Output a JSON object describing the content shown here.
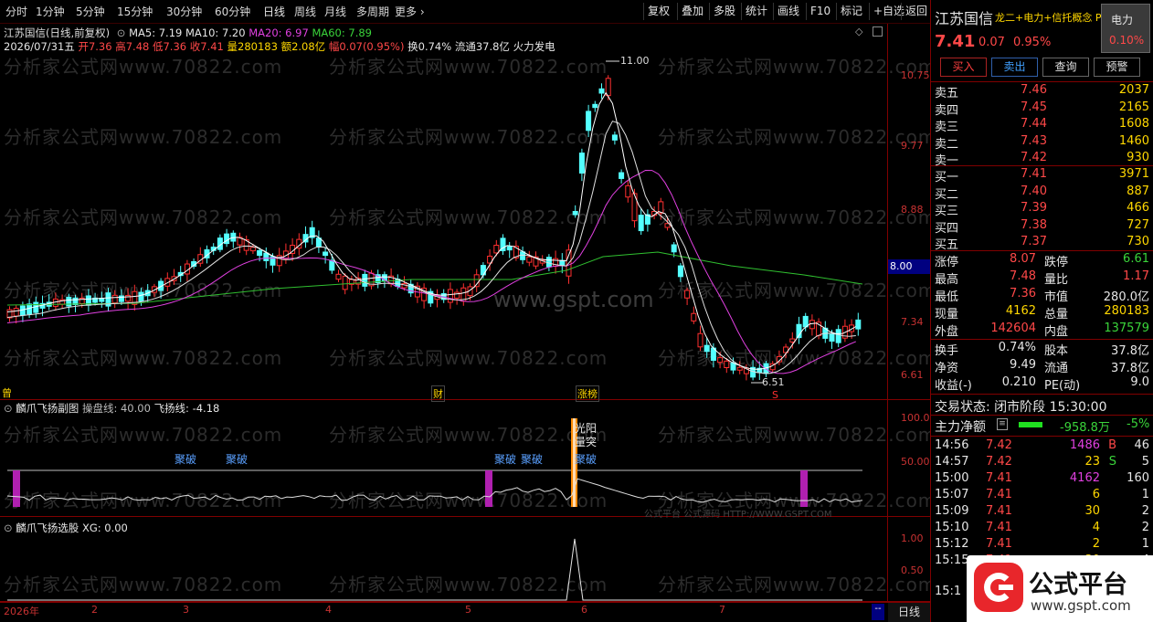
{
  "toolbar": {
    "periods": [
      "分时",
      "1分钟",
      "5分钟",
      "15分钟",
      "30分钟",
      "60分钟",
      "日线",
      "周线",
      "月线",
      "多周期",
      "更多"
    ],
    "right": [
      "复权",
      "叠加",
      "多股",
      "统计",
      "画线",
      "F10",
      "标记",
      "+自选",
      "返回"
    ]
  },
  "main": {
    "title": "江苏国信(日线,前复权)",
    "ma5": "MA5: 7.19",
    "ma10": "MA10: 7.20",
    "ma20": "MA20: 6.97",
    "ma60": "MA60: 7.89",
    "day_info": {
      "date": "2026/07/31五",
      "open_l": "开",
      "open": "7.36",
      "high_l": "高",
      "high": "7.48",
      "low_l": "低",
      "low": "7.36",
      "close_l": "收",
      "close": "7.41",
      "vol_l": "量",
      "vol": "280183",
      "amt_l": "额",
      "amt": "2.08亿",
      "chg_l": "幅",
      "chg": "0.07(0.95%)",
      "rest": "换0.74% 流通37.8亿 火力发电"
    },
    "price_ticks": [
      "10.75",
      "9.77",
      "8.88",
      "8.00",
      "7.34",
      "6.61"
    ],
    "max_label": "11.00",
    "min_label": "6.51",
    "markers": {
      "left": "曾",
      "cai": "财",
      "zhangbang": "涨榜",
      "s": "S"
    },
    "watermark": "分析家公式网www.70822.com",
    "gspt": "www.gspt.com"
  },
  "sub1": {
    "title": "麟爪飞扬副图",
    "p1": "操盘线: 40.00",
    "p2": "飞扬线: -4.18",
    "ticks": [
      "100.0",
      "50.00"
    ],
    "labels": [
      "聚破",
      "聚破",
      "聚破",
      "聚破",
      "聚破"
    ],
    "vertical_text": "光阳量突",
    "footer_wm": "公式平台 公式源码 HTTP://WWW.GSPT.COM"
  },
  "sub2": {
    "title": "麟爪飞扬选股",
    "p1": "XG: 0.00",
    "ticks": [
      "1.00",
      "0.50"
    ]
  },
  "xaxis": {
    "labels": [
      "2026年",
      "2",
      "3",
      "4",
      "5",
      "6",
      "7"
    ],
    "period": "日线",
    "dash": "--"
  },
  "panel": {
    "name": "江苏国信",
    "concepts": "龙二+电力+信托概念 P",
    "sector_badge": "电力",
    "sector_pct": "0.10%",
    "price": "7.41",
    "change": "0.07",
    "pct": "0.95%",
    "buttons": [
      "买入",
      "卖出",
      "查询",
      "预警"
    ],
    "asks": [
      {
        "l": "卖五",
        "p": "7.46",
        "v": "2037"
      },
      {
        "l": "卖四",
        "p": "7.45",
        "v": "2165"
      },
      {
        "l": "卖三",
        "p": "7.44",
        "v": "1608"
      },
      {
        "l": "卖二",
        "p": "7.43",
        "v": "1460"
      },
      {
        "l": "卖一",
        "p": "7.42",
        "v": "930"
      }
    ],
    "bids": [
      {
        "l": "买一",
        "p": "7.41",
        "v": "3971"
      },
      {
        "l": "买二",
        "p": "7.40",
        "v": "887"
      },
      {
        "l": "买三",
        "p": "7.39",
        "v": "466"
      },
      {
        "l": "买四",
        "p": "7.38",
        "v": "727"
      },
      {
        "l": "买五",
        "p": "7.37",
        "v": "730"
      }
    ],
    "stats": [
      {
        "l1": "涨停",
        "v1": "8.07",
        "l2": "跌停",
        "v2": "6.61"
      },
      {
        "l1": "最高",
        "v1": "7.48",
        "l2": "量比",
        "v2": "1.17"
      },
      {
        "l1": "最低",
        "v1": "7.36",
        "l2": "市值",
        "v2": "280.0亿"
      },
      {
        "l1": "现量",
        "v1": "4162",
        "l2": "总量",
        "v2": "280183"
      },
      {
        "l1": "外盘",
        "v1": "142604",
        "l2": "内盘",
        "v2": "137579"
      }
    ],
    "stats2": [
      {
        "l1": "换手",
        "v1": "0.74%",
        "l2": "股本",
        "v2": "37.8亿"
      },
      {
        "l1": "净资",
        "v1": "9.49",
        "l2": "流通",
        "v2": "37.8亿"
      },
      {
        "l1": "收益(-)",
        "v1": "0.210",
        "l2": "PE(动)",
        "v2": "9.0"
      }
    ],
    "trade_state": "交易状态: 闭市阶段 15:30:00",
    "main_flow": "主力净额",
    "main_flow_val": "-958.8万",
    "main_flow_pct": "-5%",
    "ticks": [
      {
        "t": "14:56",
        "p": "7.42",
        "v": "1486",
        "s": "B",
        "n": "46"
      },
      {
        "t": "14:57",
        "p": "7.42",
        "v": "23",
        "s": "S",
        "n": "5"
      },
      {
        "t": "15:00",
        "p": "7.41",
        "v": "4162",
        "s": "",
        "n": "160"
      },
      {
        "t": "15:07",
        "p": "7.41",
        "v": "6",
        "s": "",
        "n": "1"
      },
      {
        "t": "15:09",
        "p": "7.41",
        "v": "30",
        "s": "",
        "n": "2"
      },
      {
        "t": "15:10",
        "p": "7.41",
        "v": "4",
        "s": "",
        "n": "2"
      },
      {
        "t": "15:12",
        "p": "7.41",
        "v": "2",
        "s": "",
        "n": "1"
      },
      {
        "t": "15:15",
        "p": "7.41",
        "v": "30",
        "s": "",
        "n": "4"
      }
    ],
    "last_time": "15:1",
    "logo_text": "公式平台",
    "logo_url": "www.gspt.com"
  },
  "colors": {
    "up": "#ff3030",
    "down": "#54ffff",
    "ma5": "#ffffff",
    "ma10": "#ffff00",
    "ma20": "#e040e0",
    "ma60": "#30c030",
    "axis": "#800000"
  }
}
